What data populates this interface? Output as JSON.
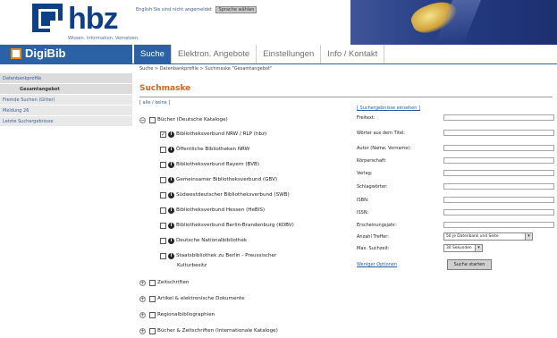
{
  "header": {
    "logo_text": "hbz",
    "logo_subtitle": "Wissen. Information. Vernetzen.",
    "lang_label": "English   Sie sind nicht angemeldet",
    "lang_select": "Sprache wählen"
  },
  "nav": {
    "brand": "DigiBib",
    "tabs": [
      "Suche",
      "Elektron. Angebote",
      "Einstellungen",
      "Info / Kontakt"
    ]
  },
  "sidebar": {
    "items": [
      "Datenbankprofile",
      "Gesamtangebot",
      "Fremde Suchen (Gitter)",
      "Meldung 26",
      "Letzte Suchergebnisse"
    ]
  },
  "main": {
    "breadcrumb": "Suche > Datenbankprofile > Suchmaske \"Gesamtangebot\"",
    "title": "Suchmaske",
    "select_all": "[ alle / keine ]",
    "categories": [
      "Bücher (Deutsche Kataloge)",
      "Bibliotheksverbund NRW / RLP (hbz)",
      "Öffentliche Bibliotheken NRW",
      "Bibliotheksverbund Bayern (BVB)",
      "Gemeinsamer Bibliotheksverbund (GBV)",
      "Südwestdeutscher Bibliotheksverbund (SWB)",
      "Bibliotheksverbund Hessen (HeBIS)",
      "Bibliotheksverbund Berlin-Brandenburg (KOBV)",
      "Deutsche Nationalbibliothek",
      "Staatsbibliothek zu Berlin - Preussischer",
      "Kulturbesitz",
      "Zeitschriften",
      "Artikel & elektronische Dokumente",
      "Regionalbibliographien",
      "Bücher & Zeitschriften (Internationale Kataloge)"
    ]
  },
  "form": {
    "links": "[ Suchergebnisse einsehen ]",
    "fields": [
      "Freitext:",
      "Wörter aus dem Titel:",
      "Autor (Name, Vorname):",
      "Körperschaft:",
      "Verlag:",
      "Schlagwörter:",
      "ISBN:",
      "ISSN:",
      "Erscheinungsjahr:"
    ],
    "hits_label": "Anzahl Treffer:",
    "hits_value": "50 je Datenbank und Seite",
    "timeout_label": "Max. Suchzeit:",
    "timeout_value": "30 Sekunden",
    "search_options_link": "Weniger Optionen",
    "submit": "Suche starten"
  }
}
